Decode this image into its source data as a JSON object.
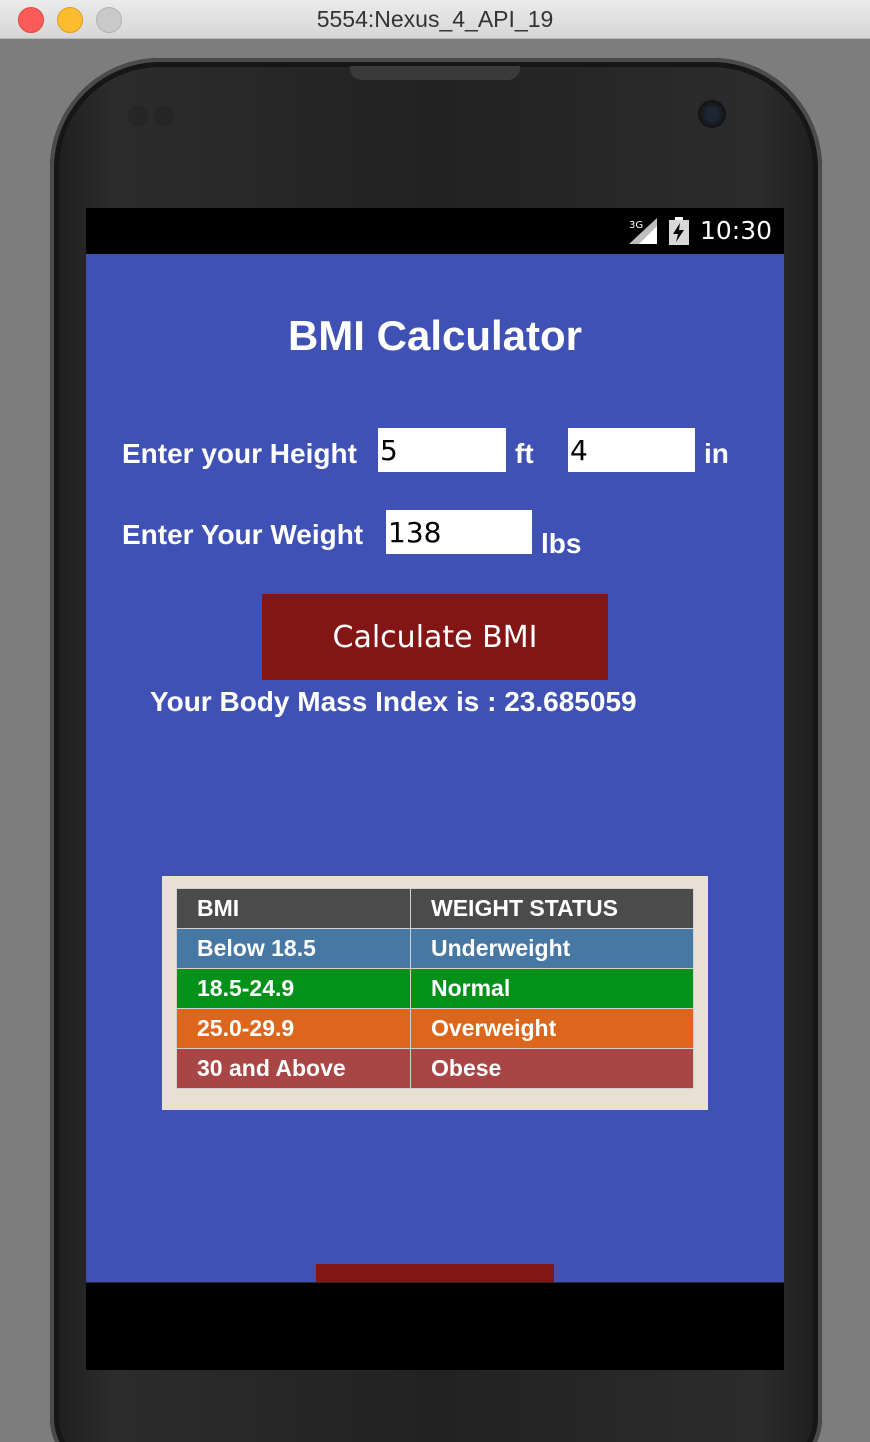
{
  "window": {
    "title": "5554:Nexus_4_API_19"
  },
  "status_bar": {
    "time": "10:30",
    "network": "3G"
  },
  "app": {
    "title": "BMI Calculator",
    "height_label": "Enter your Height",
    "feet_value": "5",
    "feet_unit": "ft",
    "inches_value": "4",
    "inches_unit": "in",
    "weight_label": "Enter Your Weight",
    "weight_value": "138",
    "weight_unit": "lbs",
    "calculate_label": "Calculate BMI",
    "result_text": "Your Body Mass Index is : 23.685059"
  },
  "bmi_table": {
    "headers": [
      "BMI",
      "WEIGHT STATUS"
    ],
    "rows": [
      {
        "range": "Below 18.5",
        "status": "Underweight",
        "color": "#4778a4"
      },
      {
        "range": "18.5-24.9",
        "status": "Normal",
        "color": "#03911a"
      },
      {
        "range": "25.0-29.9",
        "status": "Overweight",
        "color": "#dc671c"
      },
      {
        "range": "30 and Above",
        "status": "Obese",
        "color": "#a84646"
      }
    ]
  },
  "colors": {
    "app_background": "#3f51b5",
    "button_background": "#841515"
  }
}
